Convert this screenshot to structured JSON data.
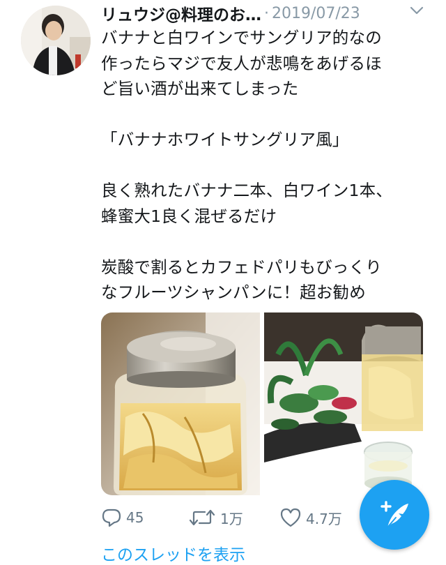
{
  "tweet": {
    "author_name": "リュウジ@料理のお…",
    "separator": "·",
    "timestamp": "2019/07/23",
    "text_lines": [
      "バナナと白ワインでサングリア的なの",
      "作ったらマジで友人が悲鳴をあげるほ",
      "ど旨い酒が出来てしまった",
      "",
      "「バナナホワイトサングリア風」",
      "",
      "良く熟れたバナナ二本、白ワイン1本、",
      "蜂蜜大1良く混ぜるだけ",
      "",
      "炭酸で割るとカフェドパリもびっくり",
      "なフルーツシャンパンに！超お勧め"
    ],
    "media": [
      {
        "icon": "photo-banana-jar"
      },
      {
        "icon": "photo-jar-with-plant"
      }
    ]
  },
  "actions": {
    "reply": {
      "icon": "reply-icon",
      "count": "45"
    },
    "retweet": {
      "icon": "retweet-icon",
      "count": "1万"
    },
    "like": {
      "icon": "heart-icon",
      "count": "4.7万"
    }
  },
  "thread_link": "このスレッドを表示",
  "compose": {
    "icon": "compose-feather-icon"
  },
  "colors": {
    "accent": "#1da1f2",
    "muted": "#657786",
    "text": "#14171a"
  }
}
